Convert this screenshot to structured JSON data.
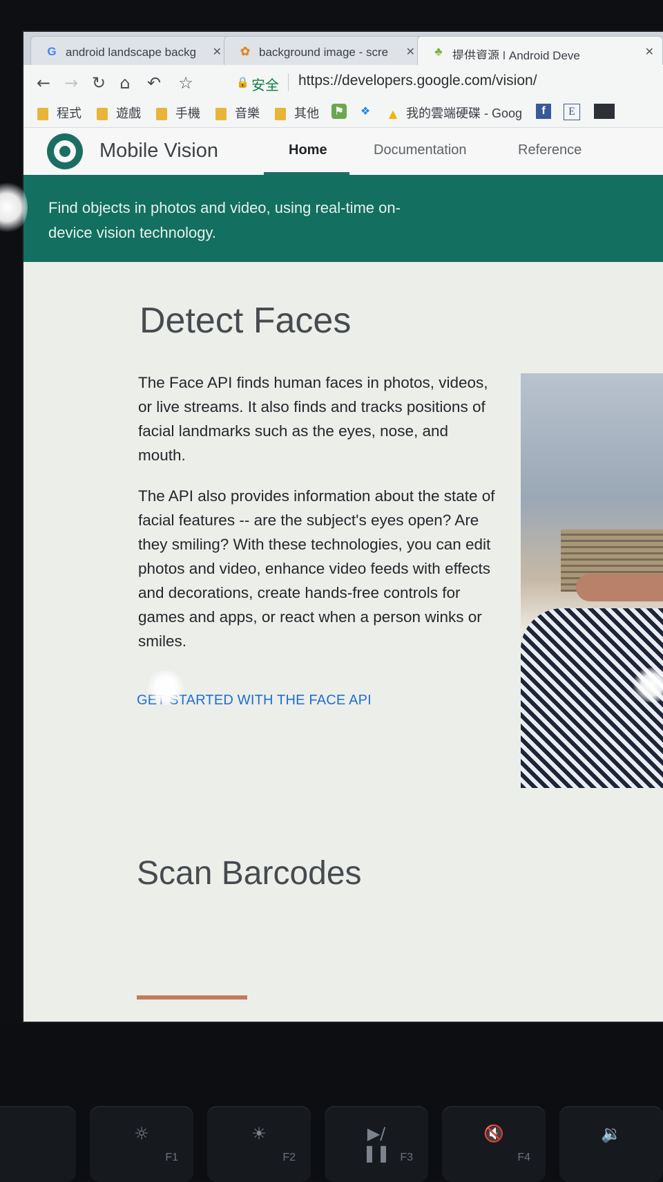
{
  "browser": {
    "tabs": [
      {
        "favicon": "G",
        "title": "android landscape backg",
        "active": true
      },
      {
        "favicon": "✿",
        "title": "background image - scre",
        "active": false
      },
      {
        "favicon": "♣",
        "title": "提供資源 | Android Deve",
        "active": false
      }
    ],
    "close_glyph": "✕",
    "toolbar": {
      "back": "←",
      "forward": "→",
      "reload": "↻",
      "home": "⌂",
      "undo": "↶",
      "bookmark_star": "☆",
      "secure_label": "安全",
      "url": "https://developers.google.com/vision/"
    },
    "bookmarks": [
      {
        "icon": "folder-icon",
        "label": "程式"
      },
      {
        "icon": "folder-icon",
        "label": "遊戲"
      },
      {
        "icon": "folder-icon",
        "label": "手機"
      },
      {
        "icon": "folder-icon",
        "label": "音樂"
      },
      {
        "icon": "folder-icon",
        "label": "其他"
      },
      {
        "icon": "bookmark-app-icon",
        "label": ""
      },
      {
        "icon": "dropbox-icon",
        "label": ""
      },
      {
        "icon": "google-drive-icon",
        "label": "我的雲端硬碟 - Goog"
      },
      {
        "icon": "facebook-icon",
        "label": "f"
      },
      {
        "icon": "e-icon",
        "label": "E"
      }
    ]
  },
  "site": {
    "brand": "Mobile Vision",
    "nav": [
      {
        "label": "Home",
        "active": true
      },
      {
        "label": "Documentation",
        "active": false
      },
      {
        "label": "Reference",
        "active": false
      }
    ],
    "hero": "Find objects in photos and video, using real-time on-device vision technology.",
    "section1": {
      "title": "Detect Faces",
      "p1": "The Face API finds human faces in photos, videos, or live streams. It also finds and tracks positions of facial landmarks such as the eyes, nose, and mouth.",
      "p2": "The API also provides information about the state of facial features -- are the subject's eyes open? Are they smiling? With these technologies, you can edit photos and video, enhance video feeds with effects and decorations, create hands-free controls for games and apps, or react when a person winks or smiles.",
      "cta": "GET STARTED WITH THE FACE API"
    },
    "section2": {
      "title": "Scan Barcodes"
    }
  },
  "keyboard": {
    "keys": [
      {
        "icon": "keyboard-backlight-down-icon",
        "glyph": "☼",
        "label": "F1"
      },
      {
        "icon": "keyboard-backlight-up-icon",
        "glyph": "☀",
        "label": "F2"
      },
      {
        "icon": "play-pause-icon",
        "glyph": "▶/❚❚",
        "label": "F3"
      },
      {
        "icon": "mute-icon",
        "glyph": "🔇",
        "label": "F4"
      },
      {
        "icon": "volume-down-icon",
        "glyph": "🔉",
        "label": ""
      }
    ]
  },
  "colors": {
    "brand_teal": "#136f60",
    "link_blue": "#1f6fce",
    "folder_yellow": "#e8b53a"
  }
}
